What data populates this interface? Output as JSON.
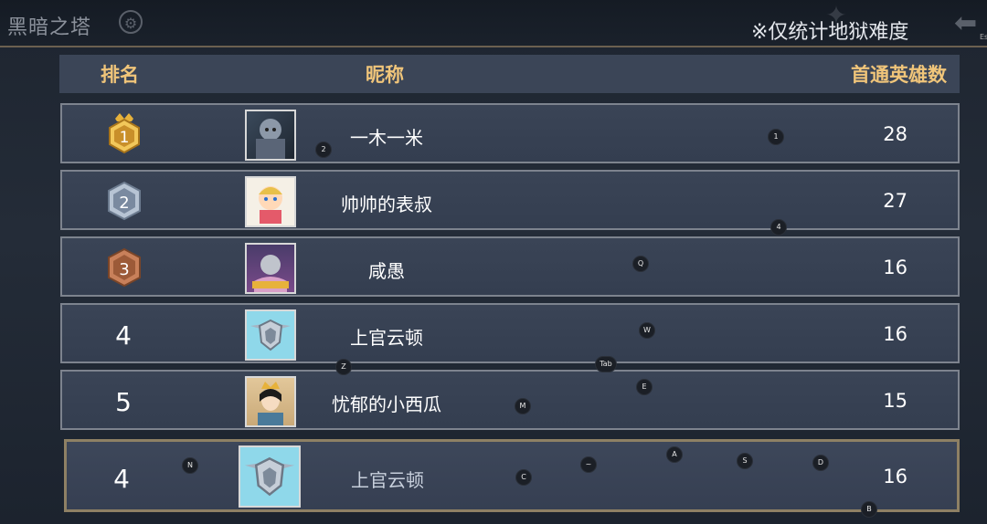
{
  "topbar": {
    "title": "黑暗之塔",
    "note": "※仅统计地狱难度",
    "back_small": "Esc"
  },
  "header": {
    "rank": "排名",
    "nickname": "昵称",
    "count": "首通英雄数"
  },
  "rows": [
    {
      "rank": "1",
      "nickname": "一木一米",
      "count": "28"
    },
    {
      "rank": "2",
      "nickname": "帅帅的表叔",
      "count": "27"
    },
    {
      "rank": "3",
      "nickname": "咸愚",
      "count": "16"
    },
    {
      "rank": "4",
      "nickname": "上官云顿",
      "count": "16"
    },
    {
      "rank": "5",
      "nickname": "忧郁的小西瓜",
      "count": "15"
    }
  ],
  "self_row": {
    "rank": "4",
    "nickname": "上官云顿",
    "count": "16"
  },
  "key_hints": {
    "k2": "2",
    "k1": "1",
    "k4": "4",
    "kq": "Q",
    "kw": "W",
    "kz": "Z",
    "ktab": "Tab",
    "ke": "E",
    "km": "M",
    "kn": "N",
    "kc": "C",
    "ktilde": "~",
    "ka": "A",
    "ks": "S",
    "kd": "D",
    "kb": "B"
  },
  "colors": {
    "header_text": "#f0c57a",
    "gold": "#d9a93a",
    "silver": "#9aaabf",
    "bronze": "#b56c45"
  }
}
